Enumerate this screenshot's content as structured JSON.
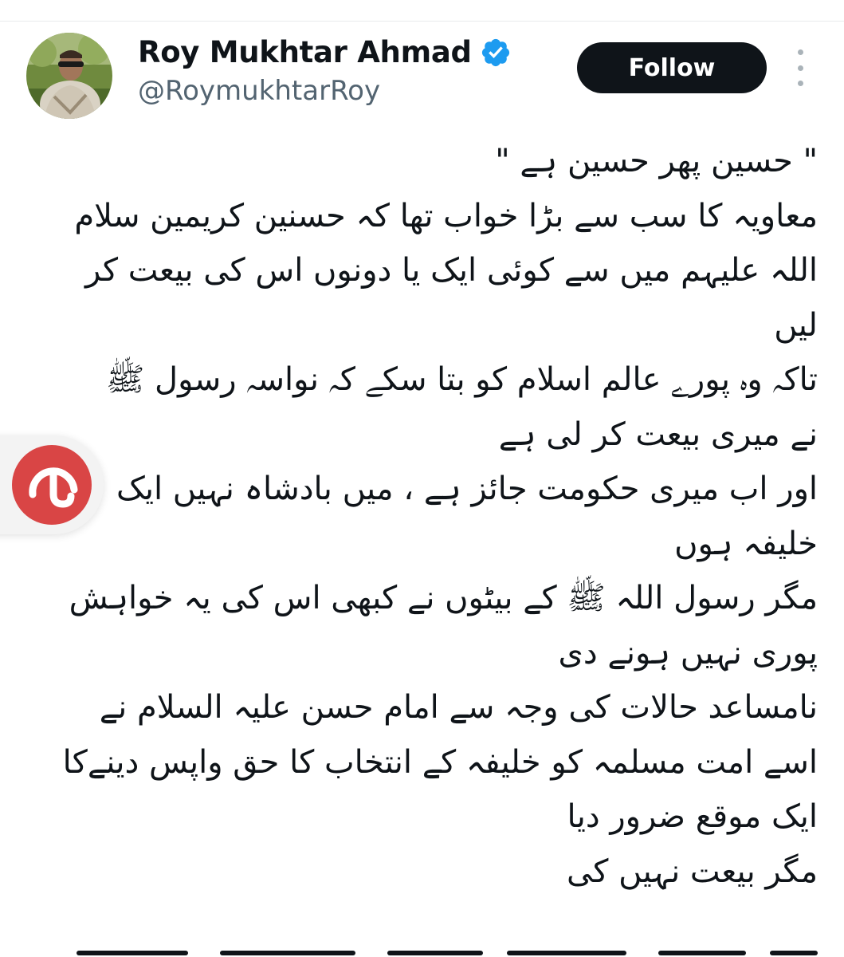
{
  "author": {
    "display_name": "Roy Mukhtar Ahmad",
    "handle": "@RoymukhtarRoy",
    "verified_icon": "verified-badge-icon",
    "verified_color": "#1d9bf0"
  },
  "actions": {
    "follow_label": "Follow",
    "more_icon": "more-vertical-icon"
  },
  "tweet": {
    "lines": [
      "\" حسین پھر حسین ہے \"",
      "معاویہ کا سب سے بڑا خواب تھا کہ حسنین کریمین سلام",
      "اللہ علیہم میں سے کوئی ایک یا دونوں اس کی بیعت کر",
      "لیں",
      "تاکہ وہ پورے عالم اسلام کو بتا سکے کہ نواسہ رسول ﷺ",
      "نے میری بیعت کر لی ہے",
      "اور اب میری حکومت جائز ہے ، میں بادشاہ نہیں ایک",
      "خلیفہ ہوں",
      "مگر رسول اللہ ﷺ کے بیٹوں نے کبھی اس کی یہ خواہش",
      "پوری نہیں ہونے دی",
      "نامساعد حالات کی وجہ سے امام حسن علیہ السلام نے",
      "اسے امت مسلمہ کو خلیفہ کے انتخاب کا حق واپس دینےکا",
      "ایک موقع ضرور دیا",
      "مگر بیعت نہیں کی"
    ]
  },
  "overlay": {
    "badge_icon": "umbrella-logo-icon",
    "badge_color": "#d94545"
  },
  "colors": {
    "text": "#0f1419",
    "secondary": "#536471",
    "button_bg": "#0f1419",
    "button_text": "#ffffff"
  }
}
